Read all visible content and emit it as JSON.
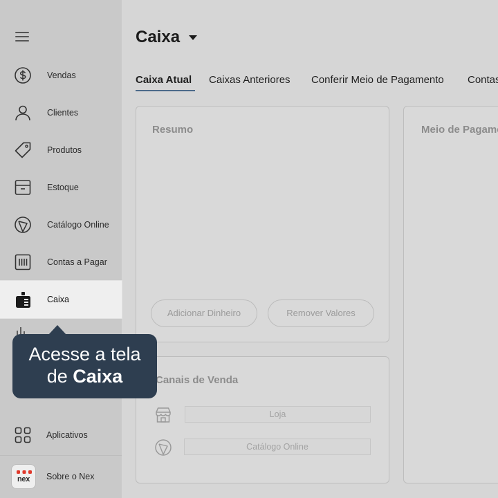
{
  "sidebar": {
    "items": [
      {
        "label": "Vendas",
        "icon": "dollar-circle-icon"
      },
      {
        "label": "Clientes",
        "icon": "user-icon"
      },
      {
        "label": "Produtos",
        "icon": "tag-icon"
      },
      {
        "label": "Estoque",
        "icon": "box-icon"
      },
      {
        "label": "Catálogo Online",
        "icon": "catalog-icon"
      },
      {
        "label": "Contas a Pagar",
        "icon": "barcode-icon"
      },
      {
        "label": "Caixa",
        "icon": "cash-register-icon",
        "active": true
      }
    ],
    "apps_label": "Aplicativos",
    "about_label": "Sobre o Nex",
    "logo_text": "nex"
  },
  "header": {
    "title": "Caixa"
  },
  "tabs": [
    "Caixa Atual",
    "Caixas Anteriores",
    "Conferir Meio de Pagamento",
    "Contas"
  ],
  "resumo": {
    "title": "Resumo",
    "add_button": "Adicionar Dinheiro",
    "remove_button": "Remover Valores"
  },
  "meio": {
    "title": "Meio de Pagamento"
  },
  "canais": {
    "title": "Canais de Venda",
    "items": [
      "Loja",
      "Catálogo Online"
    ]
  },
  "tooltip": {
    "line1": "Acesse a tela",
    "line2_prefix": "de",
    "line2_bold": "Caixa"
  },
  "colors": {
    "sidebar_bg": "#c9c9c9",
    "main_bg": "#d6d6d6",
    "tooltip_bg": "#2e3e50",
    "active_item_bg": "#efefef",
    "tab_accent": "#4c6a8a",
    "logo_red": "#e0392b"
  }
}
